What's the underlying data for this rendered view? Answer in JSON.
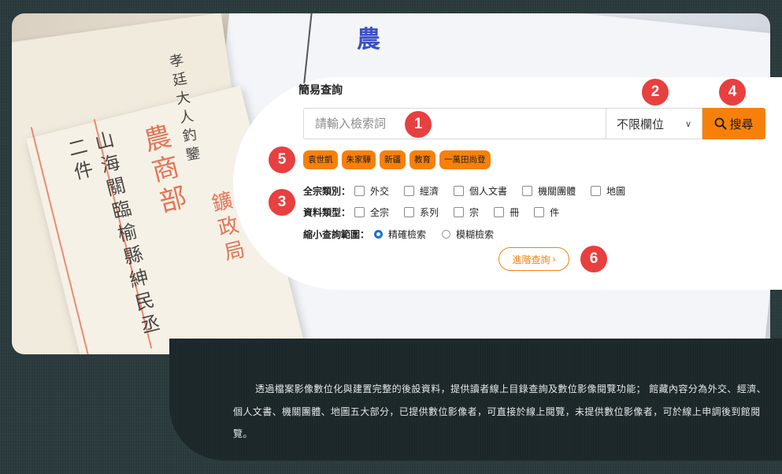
{
  "search": {
    "title": "簡易查詢",
    "placeholder": "請輸入檢索詞",
    "field_select_value": "不限欄位",
    "search_button_label": "搜尋",
    "quick_tags": [
      "袁世凱",
      "朱家驊",
      "新疆",
      "教育",
      "一萬田尚登"
    ]
  },
  "filters": {
    "category_label": "全宗類別：",
    "category_options": [
      "外交",
      "經濟",
      "個人文書",
      "機關團體",
      "地圖"
    ],
    "type_label": "資料類型：",
    "type_options": [
      "全宗",
      "系列",
      "宗",
      "冊",
      "件"
    ],
    "scope_label": "縮小查詢範圍：",
    "scope_options": [
      "精確檢索",
      "模糊檢索"
    ],
    "scope_selected": "精確檢索"
  },
  "advanced_button_label": "進階查詢",
  "badges": [
    "1",
    "2",
    "3",
    "4",
    "5",
    "6"
  ],
  "intro_text": "透過檔案影像數位化與建置完整的後設資料，提供讀者線上目錄查詢及數位影像閱覽功能； 館藏內容分為外交、經濟、個人文書、機關團體、地圖五大部分，已提供數位影像者，可直接於線上閱覽，未提供數位影像者，可於線上申調後到館閱覽。",
  "hero_text": {
    "title_red": "農商部",
    "sub_red": "鑛政局",
    "line1": "山海關臨榆縣紳民丞二件",
    "line2": "孝廷大人釣鑒",
    "seal": "農"
  },
  "colors": {
    "accent": "#f7800a",
    "badge": "#e83f3f",
    "radio": "#1a6fd8"
  }
}
